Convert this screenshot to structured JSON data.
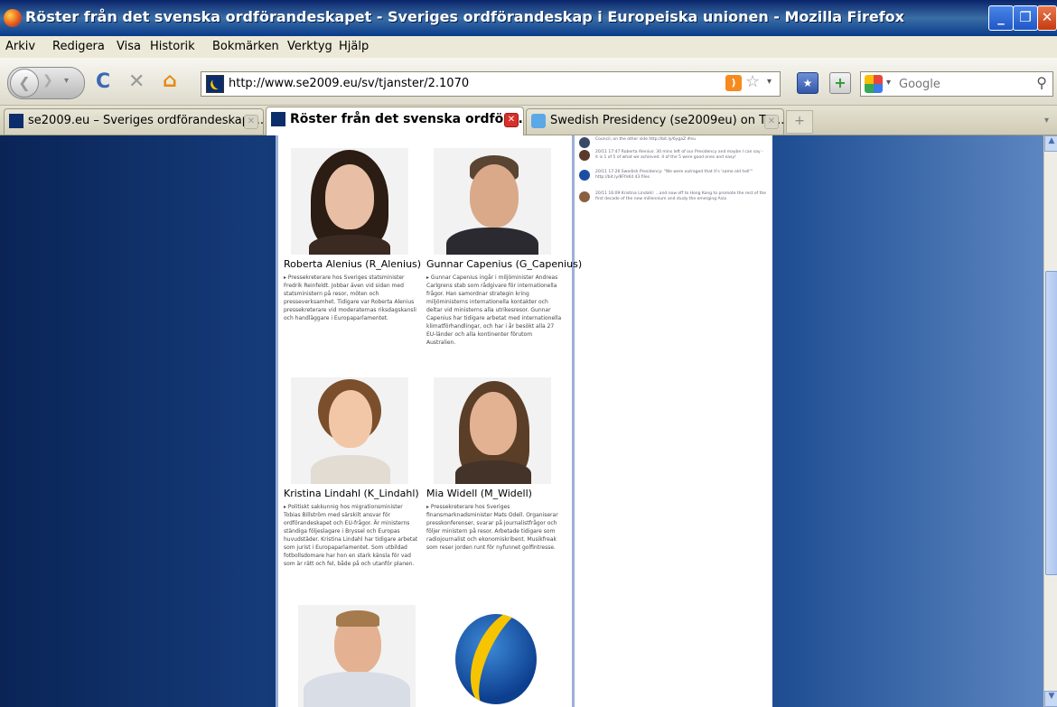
{
  "window": {
    "title": "Röster från det svenska ordförandeskapet - Sveriges ordförandeskap i Europeiska unionen - Mozilla Firefox",
    "minimize": "_",
    "maximize": "❐",
    "close": "✕"
  },
  "menu": [
    "Arkiv",
    "Redigera",
    "Visa",
    "Historik",
    "Bokmärken",
    "Verktyg",
    "Hjälp"
  ],
  "nav": {
    "url": "http://www.se2009.eu/sv/tjanster/2.1070",
    "search_placeholder": "Google"
  },
  "tabs": [
    {
      "label": "se2009.eu – Sveriges ordförandeskap i...",
      "active": false
    },
    {
      "label": "Röster från det svenska ordföra...",
      "active": true
    },
    {
      "label": "Swedish Presidency (se2009eu) on Twi...",
      "active": false
    }
  ],
  "new_tab": "+",
  "people": [
    {
      "name": "Roberta Alenius (R_Alenius)",
      "desc": "▸ Pressekreterare hos Sveriges statsminister Fredrik Reinfeldt. Jobbar även vid sidan med statsministern på resor, möten och presseverksamhet. Tidigare var Roberta Alenius pressekreterare vid moderaternas riksdagskansli och handläggare i Europaparlamentet."
    },
    {
      "name": "Gunnar Capenius (G_Capenius)",
      "desc": "▸ Gunnar Capenius ingår i miljöminister Andreas Carlgrens stab som rådgivare för internationella frågor. Han samordnar strategin kring miljöministerns internationella kontakter och deltar vid ministerns alla utrikesresor. Gunnar Capenius har tidigare arbetat med internationella klimatförhandlingar, och har i år besökt alla 27 EU-länder och alla kontinenter förutom Australien."
    },
    {
      "name": "Kristina Lindahl (K_Lindahl)",
      "desc": "▸ Politiskt sakkunnig hos migrationsminister Tobias Billström med särskilt ansvar för ordförandeskapet och EU-frågor. Är ministerns ständiga följeslagare i Bryssel och Europas huvudstäder. Kristina Lindahl har tidigare arbetat som jurist i Europaparlamentet. Som utbildad fotbollsdomare har hon en stark känsla för vad som är rätt och fel, både på och utanför planen."
    },
    {
      "name": "Mia Widell (M_Widell)",
      "desc": "▸ Pressekreterare hos Sveriges finansmarknadsminister Mats Odell. Organiserar presskonferenser, svarar på journalistfrågor och följer ministern på resor. Arbetade tidigare som radiojournalist och ekonomiskribent. Musikfreak som reser jorden runt för nyfunnet golfintresse."
    }
  ],
  "feed": [
    "Council, on the other side http://bit.ly/6ygaZ  #eu",
    "20/11 17:47 Roberta Alenius: 30 mins left of our Presidency and maybe I can say - it is 1 of 5 of what we achieved. 4 of the 5 were good ones and easy!",
    "20/11 17:26 Swedish Presidency: \"We were outraged that it's 'same old hell'\" http://bit.ly/8FfnKd 43 files",
    "20/11 16:09 Kristina Lindahl: ...and now off to Hong Kong to promote the rest of the first decade of the new millennium and study the emerging Asia"
  ],
  "colors": {
    "page_bg": "#0e2f63",
    "main_border": "#9ab1d8",
    "active_tab_close": "#d9302a"
  }
}
